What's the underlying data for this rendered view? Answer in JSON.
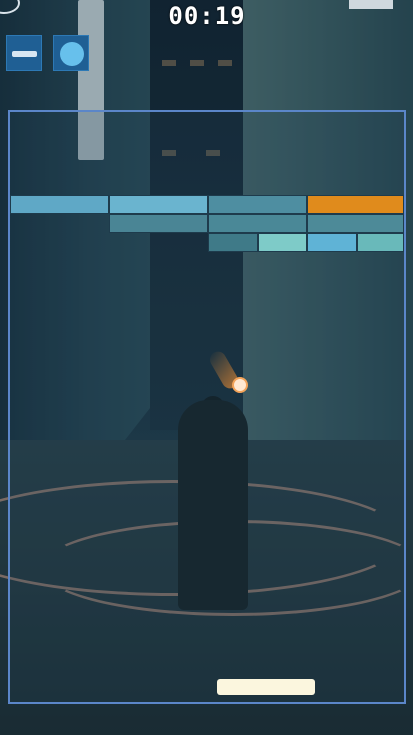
{
  "hud": {
    "timer": "00:19",
    "pause_button_label": "pause",
    "ball_button_label": "ball"
  },
  "colors": {
    "playfield_border": "#5b86c9",
    "brick_blue": "#6cb7d3",
    "brick_teal": "#5aa5b0",
    "brick_orange": "#e08b1c",
    "paddle": "#fbf6de",
    "ball": "#ffe8d2",
    "hud_button": "#1f5f94"
  },
  "bricks": [
    {
      "row": 0,
      "col": 0,
      "color": "#5fa8c6"
    },
    {
      "row": 0,
      "col": 1,
      "color": "#6ab4cf"
    },
    {
      "row": 0,
      "col": 2,
      "color": "#4e8ea1"
    },
    {
      "row": 0,
      "col": 3,
      "color": "#e08b1c"
    },
    {
      "row": 1,
      "col": 1,
      "color": "#4a8595"
    },
    {
      "row": 1,
      "col": 2,
      "color": "#4a8897"
    },
    {
      "row": 1,
      "col": 3,
      "color": "#4d8a98"
    },
    {
      "row": 2,
      "col": 2,
      "color": "#3f7a88"
    },
    {
      "row": 2,
      "col": 2.5,
      "color": "#7ecbc8"
    },
    {
      "row": 2,
      "col": 3,
      "color": "#5fb3d6"
    },
    {
      "row": 2,
      "col": 3.5,
      "color": "#69b9ba"
    }
  ]
}
